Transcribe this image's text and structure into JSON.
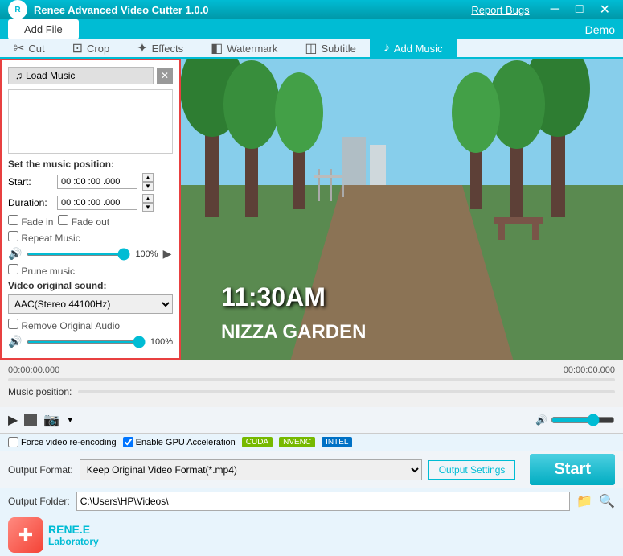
{
  "app": {
    "title": "Renee Advanced Video Cutter 1.0.0",
    "report_bugs": "Report Bugs",
    "demo": "Demo"
  },
  "toolbar": {
    "add_file": "Add File"
  },
  "tabs": [
    {
      "id": "cut",
      "label": "Cut",
      "icon": "✂"
    },
    {
      "id": "crop",
      "label": "Crop",
      "icon": "⊡"
    },
    {
      "id": "effects",
      "label": "Effects",
      "icon": "✦"
    },
    {
      "id": "watermark",
      "label": "Watermark",
      "icon": "◧"
    },
    {
      "id": "subtitle",
      "label": "Subtitle",
      "icon": "◫"
    },
    {
      "id": "add_music",
      "label": "Add Music",
      "icon": "♪"
    }
  ],
  "left_panel": {
    "load_music": "Load Music",
    "set_position_label": "Set the music position:",
    "start_label": "Start:",
    "start_value": "00 :00 :00 .000",
    "duration_label": "Duration:",
    "duration_value": "00 :00 :00 .000",
    "fade_in": "Fade in",
    "fade_out": "Fade out",
    "repeat_music": "Repeat Music",
    "volume_pct": "100%",
    "prune_music": "Prune music",
    "video_original_sound": "Video original sound:",
    "audio_format": "AAC(Stereo 44100Hz)",
    "remove_original_audio": "Remove Original Audio",
    "video_volume_pct": "100%"
  },
  "video": {
    "time_left": "00:00:00.000",
    "time_right": "00:00:00.000",
    "overlay_time": "11:30AM",
    "overlay_location": "NIZZA GARDEN",
    "music_position": "Music position:"
  },
  "output": {
    "format_label": "Output Format:",
    "format_value": "Keep Original Video Format(*.mp4)",
    "settings_btn": "Output Settings",
    "folder_label": "Output Folder:",
    "folder_path": "C:\\Users\\HP\\Videos\\",
    "start_btn": "Start"
  },
  "encoding": {
    "force_label": "Force video re-encoding",
    "gpu_label": "Enable GPU Acceleration",
    "cuda": "CUDA",
    "nvenc": "NVENC",
    "intel": "INTEL"
  },
  "logo": {
    "line1": "RENE.E",
    "line2": "Laboratory"
  }
}
